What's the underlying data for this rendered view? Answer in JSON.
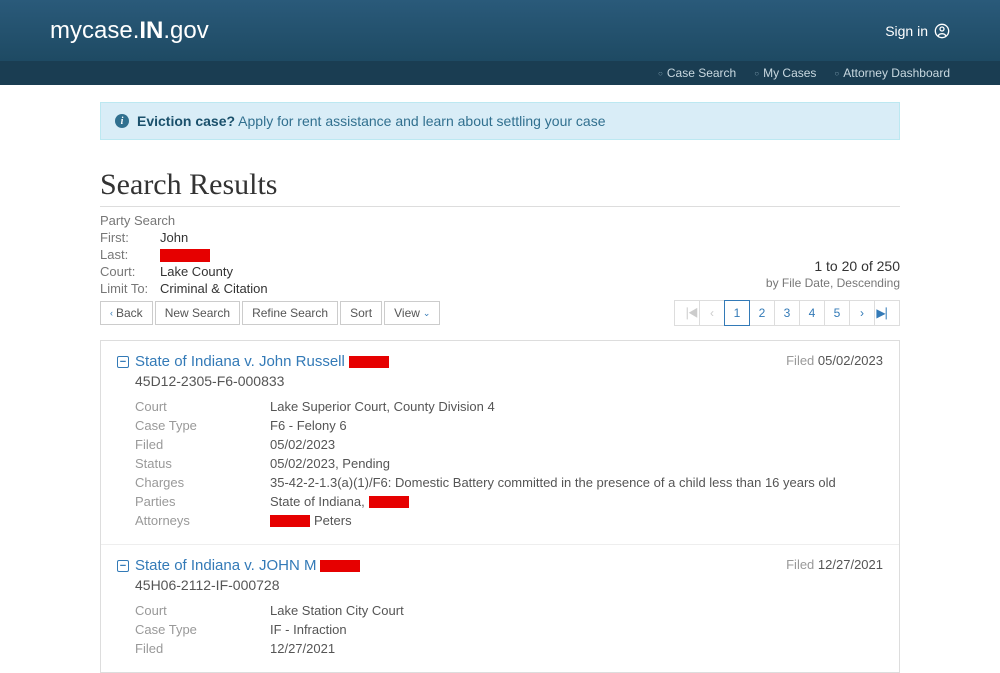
{
  "header": {
    "logo_pre": "mycase.",
    "logo_bold": "IN",
    "logo_post": ".gov",
    "signin": "Sign in"
  },
  "nav": {
    "case_search": "Case Search",
    "my_cases": "My Cases",
    "attorney_dashboard": "Attorney Dashboard"
  },
  "alert": {
    "bold": "Eviction case?",
    "text": "Apply for rent assistance and learn about settling your case"
  },
  "page_title": "Search Results",
  "search_meta": {
    "type": "Party Search",
    "first_label": "First:",
    "first_value": "John",
    "last_label": "Last:",
    "court_label": "Court:",
    "court_value": "Lake County",
    "limit_label": "Limit To:",
    "limit_value": "Criminal & Citation"
  },
  "summary": {
    "range": "1 to 20 of 250",
    "sort": "by File Date, Descending"
  },
  "buttons": {
    "back": "Back",
    "new_search": "New Search",
    "refine_search": "Refine Search",
    "sort": "Sort",
    "view": "View"
  },
  "pagination": {
    "pages": [
      "1",
      "2",
      "3",
      "4",
      "5"
    ]
  },
  "results": [
    {
      "title": "State of Indiana v. John Russell",
      "filed_label": "Filed",
      "filed_date": "05/02/2023",
      "case_number": "45D12-2305-F6-000833",
      "details": {
        "court_label": "Court",
        "court_value": "Lake Superior Court, County Division 4",
        "type_label": "Case Type",
        "type_value": "F6 - Felony 6",
        "filed_label": "Filed",
        "filed_value": "05/02/2023",
        "status_label": "Status",
        "status_value": "05/02/2023, Pending",
        "charges_label": "Charges",
        "charges_value": "35-42-2-1.3(a)(1)/F6: Domestic Battery committed in the presence of a child less than 16 years old",
        "parties_label": "Parties",
        "parties_value": "State of Indiana,",
        "attorneys_label": "Attorneys",
        "attorneys_value": "Peters"
      }
    },
    {
      "title": "State of Indiana v. JOHN M",
      "filed_label": "Filed",
      "filed_date": "12/27/2021",
      "case_number": "45H06-2112-IF-000728",
      "details": {
        "court_label": "Court",
        "court_value": "Lake Station City Court",
        "type_label": "Case Type",
        "type_value": "IF - Infraction",
        "filed_label": "Filed",
        "filed_value": "12/27/2021"
      }
    }
  ]
}
